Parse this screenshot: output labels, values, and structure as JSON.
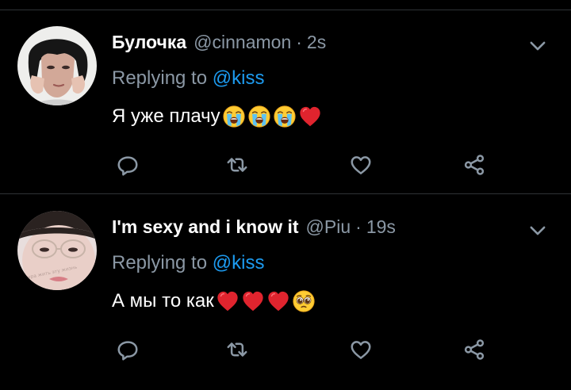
{
  "colors": {
    "background": "#000000",
    "divider": "#2f3336",
    "primary_text": "#ffffff",
    "secondary_text": "#8b98a5",
    "accent": "#1d9bf0",
    "icon": "#8b98a5"
  },
  "tweets": [
    {
      "display_name": "Булочка",
      "handle": "@cinnamon",
      "separator": "·",
      "time": "2s",
      "reply_prefix": "Replying to",
      "reply_mention": "@kiss",
      "text": "Я уже плачу",
      "emojis": [
        "loudly-crying-face-icon",
        "loudly-crying-face-icon",
        "loudly-crying-face-icon",
        "red-heart-icon"
      ],
      "actions": [
        "reply-icon",
        "retweet-icon",
        "like-icon",
        "share-icon"
      ]
    },
    {
      "display_name": "I'm sexy and i know it",
      "handle": "@Piu",
      "separator": "·",
      "time": "19s",
      "reply_prefix": "Replying to",
      "reply_mention": "@kiss",
      "text": "А мы то как",
      "avatar_caption": "ура жить эту жизнь",
      "emojis": [
        "red-heart-icon",
        "red-heart-icon",
        "red-heart-icon",
        "pleading-face-icon"
      ],
      "actions": [
        "reply-icon",
        "retweet-icon",
        "like-icon",
        "share-icon"
      ]
    }
  ]
}
